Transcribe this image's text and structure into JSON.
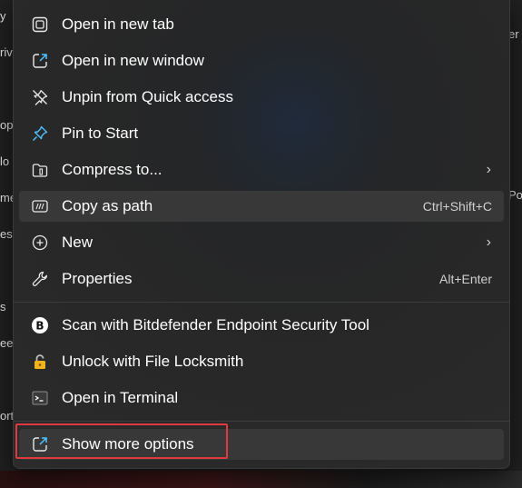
{
  "background": {
    "left_fragments": [
      "y",
      "riv",
      "op",
      "lo",
      "me",
      "es",
      "s",
      "ee",
      "ort"
    ],
    "right_fragments": [
      "er",
      "Poi"
    ]
  },
  "menu": {
    "items": [
      {
        "label": "Open in new tab",
        "icon": "open-new-tab-icon"
      },
      {
        "label": "Open in new window",
        "icon": "open-new-window-icon"
      },
      {
        "label": "Unpin from Quick access",
        "icon": "unpin-icon"
      },
      {
        "label": "Pin to Start",
        "icon": "pin-icon"
      },
      {
        "label": "Compress to...",
        "icon": "zip-folder-icon",
        "submenu": true
      },
      {
        "label": "Copy as path",
        "icon": "copy-path-icon",
        "shortcut": "Ctrl+Shift+C",
        "hovered": true
      },
      {
        "label": "New",
        "icon": "new-plus-icon",
        "submenu": true
      },
      {
        "label": "Properties",
        "icon": "wrench-icon",
        "shortcut": "Alt+Enter"
      },
      {
        "label": "Scan with Bitdefender Endpoint Security Tool",
        "icon": "bitdefender-icon"
      },
      {
        "label": "Unlock with File Locksmith",
        "icon": "lock-icon"
      },
      {
        "label": "Open in Terminal",
        "icon": "terminal-icon"
      },
      {
        "label": "Show more options",
        "icon": "show-more-options-icon",
        "highlighted": true
      }
    ],
    "submenu_glyph": "›"
  },
  "colors": {
    "menu_bg": "#2b2b2b",
    "hover_bg": "#383838",
    "highlight_border": "#e0393e",
    "accent_icon": "#4cc2ff"
  }
}
